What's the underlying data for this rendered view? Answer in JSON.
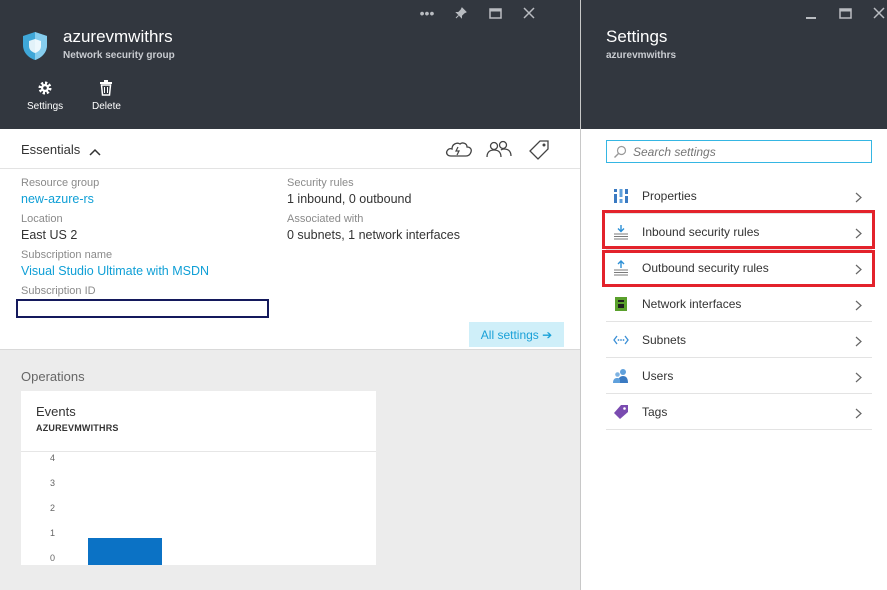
{
  "left_blade": {
    "title": "azurevmwithrs",
    "subtitle": "Network security group",
    "commands": [
      {
        "label": "Settings",
        "icon": "gear-icon"
      },
      {
        "label": "Delete",
        "icon": "trash-icon"
      }
    ],
    "essentials": {
      "label": "Essentials",
      "properties": {
        "resource_group": {
          "label": "Resource group",
          "value": "new-azure-rs"
        },
        "location": {
          "label": "Location",
          "value": "East US 2"
        },
        "subscription_name": {
          "label": "Subscription name",
          "value": "Visual Studio Ultimate with MSDN"
        },
        "subscription_id": {
          "label": "Subscription ID",
          "value": ""
        },
        "security_rules": {
          "label": "Security rules",
          "value": "1 inbound, 0 outbound"
        },
        "associated_with": {
          "label": "Associated with",
          "value": "0 subnets, 1 network interfaces"
        }
      },
      "all_settings_label": "All settings ➔"
    },
    "operations": {
      "label": "Operations",
      "tile": {
        "title": "Events",
        "subtitle": "AZUREVMWITHRS"
      }
    }
  },
  "right_blade": {
    "title": "Settings",
    "subtitle": "azurevmwithrs",
    "search_placeholder": "Search settings",
    "items": [
      {
        "label": "Properties",
        "icon": "properties-icon",
        "highlighted": false
      },
      {
        "label": "Inbound security rules",
        "icon": "inbound-rules-icon",
        "highlighted": true
      },
      {
        "label": "Outbound security rules",
        "icon": "outbound-rules-icon",
        "highlighted": true
      },
      {
        "label": "Network interfaces",
        "icon": "network-interface-icon",
        "highlighted": false
      },
      {
        "label": "Subnets",
        "icon": "subnets-icon",
        "highlighted": false
      },
      {
        "label": "Users",
        "icon": "users-icon",
        "highlighted": false
      },
      {
        "label": "Tags",
        "icon": "tag-icon",
        "highlighted": false
      }
    ]
  },
  "colors": {
    "header_bg": "#32373f",
    "link": "#0f9fd6",
    "bar": "#0b72c5",
    "highlight": "#e3222b",
    "search_border": "#35b6e3"
  },
  "chart_data": {
    "type": "bar",
    "title": "Events",
    "subtitle": "AZUREVMWITHRS",
    "yticks": [
      "4",
      "3",
      "2",
      "1",
      "0"
    ],
    "ylim": [
      0,
      4
    ],
    "series": [
      {
        "values": [
          1
        ]
      }
    ],
    "grid": false
  }
}
